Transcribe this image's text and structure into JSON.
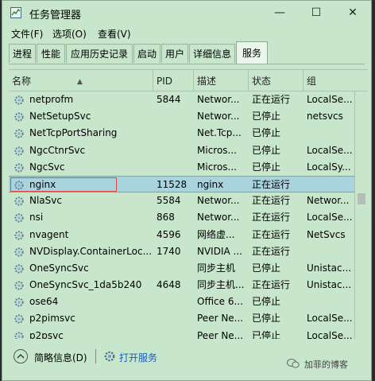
{
  "window": {
    "title": "任务管理器"
  },
  "window_buttons": {
    "minimize": "—",
    "maximize": "☐",
    "close": "✕"
  },
  "menu": [
    "文件(F)",
    "选项(O)",
    "查看(V)"
  ],
  "tabs": [
    "进程",
    "性能",
    "应用历史记录",
    "启动",
    "用户",
    "详细信息",
    "服务"
  ],
  "active_tab": "服务",
  "columns": {
    "name": "名称",
    "pid": "PID",
    "desc": "描述",
    "status": "状态",
    "group": "组"
  },
  "rows": [
    {
      "name": "netprofm",
      "pid": "5844",
      "desc": "Networ...",
      "status": "正在运行",
      "group": "LocalSe..."
    },
    {
      "name": "NetSetupSvc",
      "pid": "",
      "desc": "Networ...",
      "status": "已停止",
      "group": "netsvcs"
    },
    {
      "name": "NetTcpPortSharing",
      "pid": "",
      "desc": "Net.Tcp...",
      "status": "已停止",
      "group": ""
    },
    {
      "name": "NgcCtnrSvc",
      "pid": "",
      "desc": "Micros...",
      "status": "已停止",
      "group": "LocalSe..."
    },
    {
      "name": "NgcSvc",
      "pid": "",
      "desc": "Micros...",
      "status": "已停止",
      "group": "LocalSy..."
    },
    {
      "name": "nginx",
      "pid": "11528",
      "desc": "nginx",
      "status": "正在运行",
      "group": ""
    },
    {
      "name": "NlaSvc",
      "pid": "5584",
      "desc": "Networ...",
      "status": "正在运行",
      "group": "Networ..."
    },
    {
      "name": "nsi",
      "pid": "868",
      "desc": "Networ...",
      "status": "正在运行",
      "group": "LocalSe..."
    },
    {
      "name": "nvagent",
      "pid": "4596",
      "desc": "网络虚...",
      "status": "正在运行",
      "group": "NetSvcs"
    },
    {
      "name": "NVDisplay.ContainerLoc...",
      "pid": "1740",
      "desc": "NVIDIA ...",
      "status": "正在运行",
      "group": ""
    },
    {
      "name": "OneSyncSvc",
      "pid": "",
      "desc": "同步主机",
      "status": "已停止",
      "group": "Unistac..."
    },
    {
      "name": "OneSyncSvc_1da5b240",
      "pid": "4648",
      "desc": "同步主机...",
      "status": "正在运行",
      "group": "Unistac..."
    },
    {
      "name": "ose64",
      "pid": "",
      "desc": "Office 6...",
      "status": "已停止",
      "group": ""
    },
    {
      "name": "p2pimsvc",
      "pid": "",
      "desc": "Peer Ne...",
      "status": "已停止",
      "group": "LocalSe..."
    },
    {
      "name": "p2psvc",
      "pid": "",
      "desc": "Peer Ne...",
      "status": "已停止",
      "group": "LocalSe..."
    }
  ],
  "selected_row": "nginx",
  "bottom": {
    "collapse_label": "简略信息(D)",
    "open_services_label": "打开服务"
  },
  "watermark": "加菲的博客",
  "colors": {
    "background": "#c7e6cc",
    "selection": "#a9d4de",
    "highlight_box": "#e04848",
    "link": "#1a5fb4"
  }
}
